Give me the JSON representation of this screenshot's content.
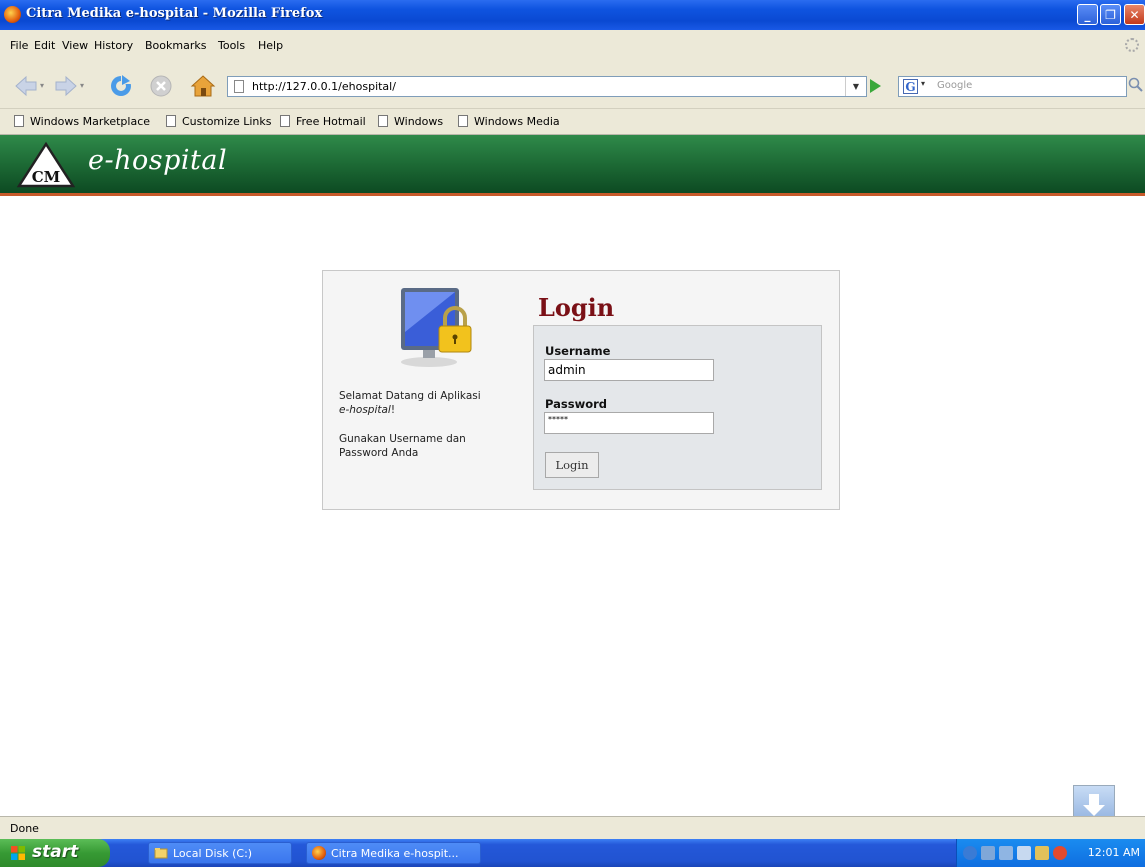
{
  "window": {
    "title": "Citra Medika e-hospital - Mozilla Firefox"
  },
  "menu": {
    "items": [
      "File",
      "Edit",
      "View",
      "History",
      "Bookmarks",
      "Tools",
      "Help"
    ]
  },
  "nav": {
    "url": "http://127.0.0.1/ehospital/",
    "search_placeholder": "Google"
  },
  "bookmarks": {
    "items": [
      "Windows Marketplace",
      "Customize Links",
      "Free Hotmail",
      "Windows",
      "Windows Media"
    ]
  },
  "header": {
    "logo_text": "CM",
    "brand": "e-hospital"
  },
  "login": {
    "title": "Login",
    "welcome_line": "Selamat Datang di Aplikasi",
    "welcome_app": "e-hospital",
    "welcome_suffix": "!",
    "instruction": "Gunakan Username dan Password Anda",
    "username_label": "Username",
    "username_value": "admin",
    "password_label": "Password",
    "password_value": "*****",
    "button_label": "Login"
  },
  "status": {
    "text": "Done"
  },
  "taskbar": {
    "start_label": "start",
    "tasks": [
      "Local Disk (C:)",
      "Citra Medika e-hospit..."
    ],
    "clock": "12:01 AM"
  },
  "colors": {
    "title_bar": "#0a49d2",
    "header_green": "#1d6a35",
    "header_accent": "#c75a2a",
    "login_title": "#7a1016"
  }
}
